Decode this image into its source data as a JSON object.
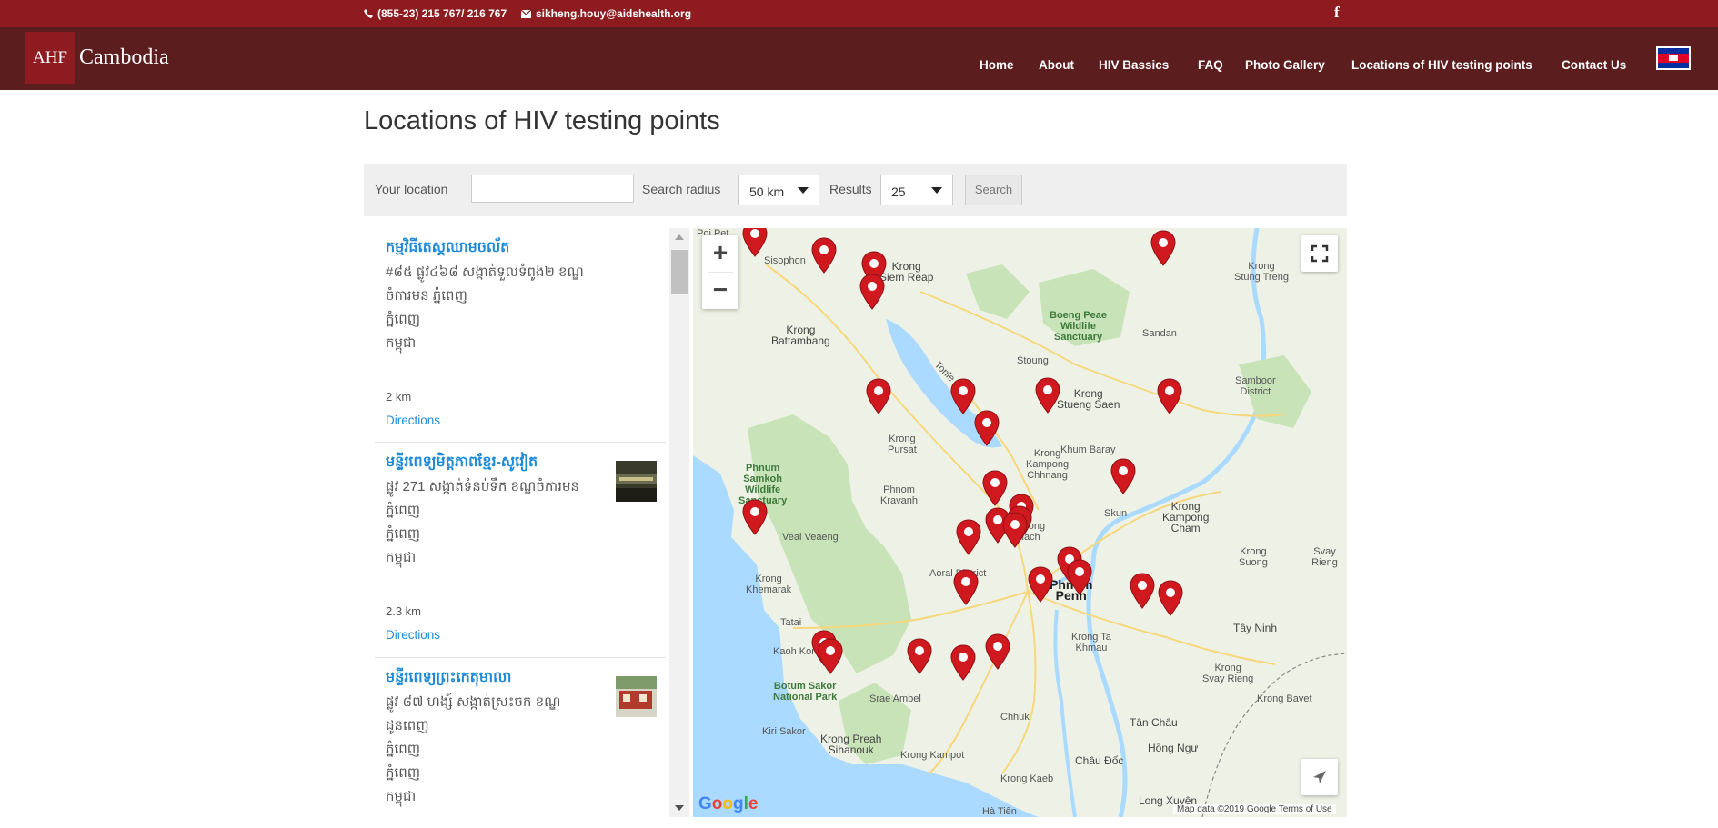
{
  "topbar": {
    "phone": "(855-23) 215 767/ 216 767",
    "email": "sikheng.houy@aidshealth.org",
    "social_icon": "f"
  },
  "header": {
    "logo_box": "AHF",
    "logo_name": "Cambodia",
    "nav": [
      "Home",
      "About",
      "HIV Bassics",
      "FAQ",
      "Photo Gallery",
      "Locations of HIV testing points",
      "Contact Us"
    ],
    "flag_icon": "cambodia-flag-icon"
  },
  "page": {
    "title": "Locations of HIV testing points"
  },
  "search": {
    "location_label": "Your location",
    "location_value": "",
    "radius_label": "Search radius",
    "radius_value": "50 km",
    "results_label": "Results",
    "results_value": "25",
    "button": "Search"
  },
  "results": [
    {
      "title": "កម្មវិធីតេស្តឈាមចល័ត",
      "address": [
        "#៨៥ ផ្លូវ៤៦៨ សង្កាត់ទួលទំពូង២ ខណ្ឌចំការមន ភ្នំពេញ",
        "ភ្នំពេញ",
        "កម្ពុជា"
      ],
      "distance": "2 km",
      "directions": "Directions"
    },
    {
      "title": "មន្ទីរពេទ្យមិត្តភាពខ្មែរ-សូវៀត",
      "address": [
        "ផ្លូវ 271 សង្កាត់ទំនប់ទឹក ខណ្ឌចំការមន ភ្នំពេញ",
        "ភ្នំពេញ",
        "កម្ពុជា"
      ],
      "distance": "2.3 km",
      "directions": "Directions"
    },
    {
      "title": "មន្ទីរពេទ្យព្រះកេតុមាលា",
      "address": [
        "ផ្លូវ ៨៧ ហង្ស៍ សង្កាត់ស្រះចក ខណ្ឌដូនពេញ",
        "ភ្នំពេញ",
        "ភ្នំពេញ",
        "កម្ពុជា"
      ],
      "distance": "",
      "directions": ""
    }
  ],
  "map": {
    "zoom_in": "+",
    "zoom_out": "−",
    "google_logo": "Google",
    "attribution": "Map data ©2019 Google    Terms of Use",
    "labels": {
      "l1": "Poi Pet",
      "l2": "Sisophon",
      "l3": "Krong\nSiem Reap",
      "l4": "Krong\nBattambang",
      "l5": "Boeng Peae\nWildlife\nSanctuary",
      "l6": "Krong\nStung Treng",
      "l7": "Samboor\nDistrict",
      "l8": "Phnum\nSamkoh\nWildlife\nSanctuary",
      "l9": "Krong\nStueng Saen",
      "l10": "Tonle Sap",
      "l11": "Krong\nKampong\nCham",
      "l12": "Phnom\nPenh",
      "l13": "Tây Ninh",
      "l14": "Botum Sakor\nNational Park",
      "l15": "Krong Preah\nSihanouk",
      "l16": "Krong Kampot",
      "l17": "Krong Kaeb",
      "l18": "Tân Châu",
      "l19": "Hồng Ngự",
      "l20": "Châu Đốc",
      "l21": "Long Xuyên",
      "l22": "Hà Tiên",
      "l23": "Krong Bavet",
      "l24": "Krong\nSvay Rieng",
      "l25": "Krong Ta\nKhmau",
      "l26": "Krong\nPursat",
      "l27": "Krong\nKampong\nChhnang",
      "l28": "Veal Veaeng",
      "l29": "Aoral District",
      "l30": "Krong\nKhemarak",
      "l31": "Sandan",
      "l32": "Stoung",
      "l33": "Chhuk",
      "l34": "Srae Ambel",
      "l35": "Kiri Sakor",
      "l36": "Tatai",
      "l37": "Kaoh Kong",
      "l38": "Krong\nSuong",
      "l39": "Phnom\nKravanh",
      "l40": "Skun",
      "l41": "Kampong\nTralach",
      "l42": "Khum Baray",
      "l43": "Svay Rieng"
    }
  }
}
